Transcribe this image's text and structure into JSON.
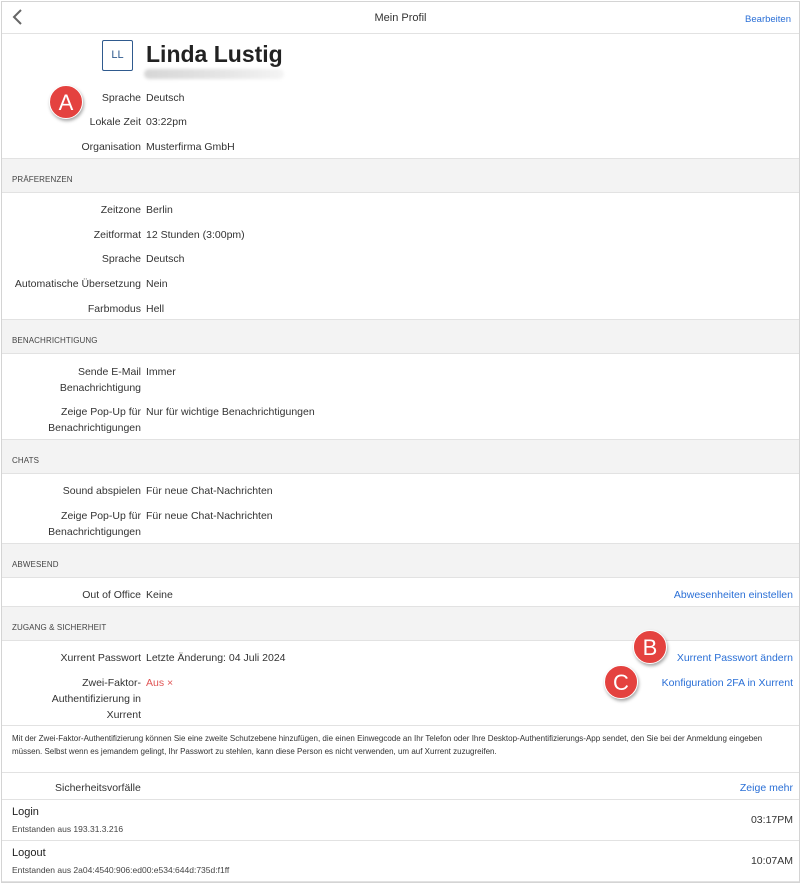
{
  "header": {
    "title": "Mein Profil",
    "edit_label": "Bearbeiten"
  },
  "profile": {
    "initials": "LL",
    "name": "Linda Lustig",
    "fields": [
      {
        "label": "Sprache",
        "value": "Deutsch"
      },
      {
        "label": "Lokale Zeit",
        "value": "03:22pm"
      },
      {
        "label": "Organisation",
        "value": "Musterfirma GmbH"
      }
    ]
  },
  "preferences": {
    "heading": "PRÄFERENZEN",
    "fields": [
      {
        "label": "Zeitzone",
        "value": "Berlin"
      },
      {
        "label": "Zeitformat",
        "value": "12 Stunden (3:00pm)"
      },
      {
        "label": "Sprache",
        "value": "Deutsch"
      },
      {
        "label": "Automatische Übersetzung",
        "value": "Nein"
      },
      {
        "label": "Farbmodus",
        "value": "Hell"
      }
    ]
  },
  "notifications": {
    "heading": "BENACHRICHTIGUNG",
    "fields": [
      {
        "label_line1": "Sende E-Mail",
        "label_line2": "Benachrichtigung",
        "value": "Immer"
      },
      {
        "label_line1": "Zeige Pop-Up für",
        "label_line2": "Benachrichtigungen",
        "value": "Nur für wichtige Benachrichtigungen"
      }
    ]
  },
  "chats": {
    "heading": "CHATS",
    "fields": [
      {
        "label": "Sound abspielen",
        "value": "Für neue Chat-Nachrichten"
      },
      {
        "label_line1": "Zeige Pop-Up für",
        "label_line2": "Benachrichtigungen",
        "value": "Für neue Chat-Nachrichten"
      }
    ]
  },
  "absent": {
    "heading": "ABWESEND",
    "label": "Out of Office",
    "value": "Keine",
    "link": "Abwesenheiten einstellen"
  },
  "security": {
    "heading": "ZUGANG & SICHERHEIT",
    "password_label": "Xurrent Passwort",
    "password_value": "Letzte Änderung: 04 Juli 2024",
    "password_link": "Xurrent Passwort ändern",
    "twofa_label_line1": "Zwei-Faktor-",
    "twofa_label_line2": "Authentifizierung in",
    "twofa_label_line3": "Xurrent",
    "twofa_value": "Aus",
    "twofa_x": "×",
    "twofa_link": "Konfiguration 2FA in Xurrent",
    "info_text": "Mit der Zwei-Faktor-Authentifizierung können Sie eine zweite Schutzebene hinzufügen, die einen Einwegcode an Ihr Telefon oder Ihre Desktop-Authentifizierungs-App sendet, den Sie bei der Anmeldung eingeben müssen. Selbst wenn es jemandem gelingt, Ihr Passwort zu stehlen, kann diese Person es nicht verwenden, um auf Xurrent zuzugreifen."
  },
  "incidents": {
    "title": "Sicherheitsvorfälle",
    "more_link": "Zeige mehr",
    "items": [
      {
        "title": "Login",
        "subtitle": "Entstanden aus 193.31.3.216",
        "time": "03:17PM"
      },
      {
        "title": "Logout",
        "subtitle": "Entstanden aus 2a04:4540:906:ed00:e534:644d:735d:f1ff",
        "time": "10:07AM"
      }
    ]
  },
  "markers": [
    "A",
    "B",
    "C"
  ],
  "colors": {
    "link": "#2a6fd6",
    "marker": "#e4423f",
    "section_bg": "#f3f3f3",
    "avatar_border": "#2f5a8e",
    "off": "#e05555"
  }
}
